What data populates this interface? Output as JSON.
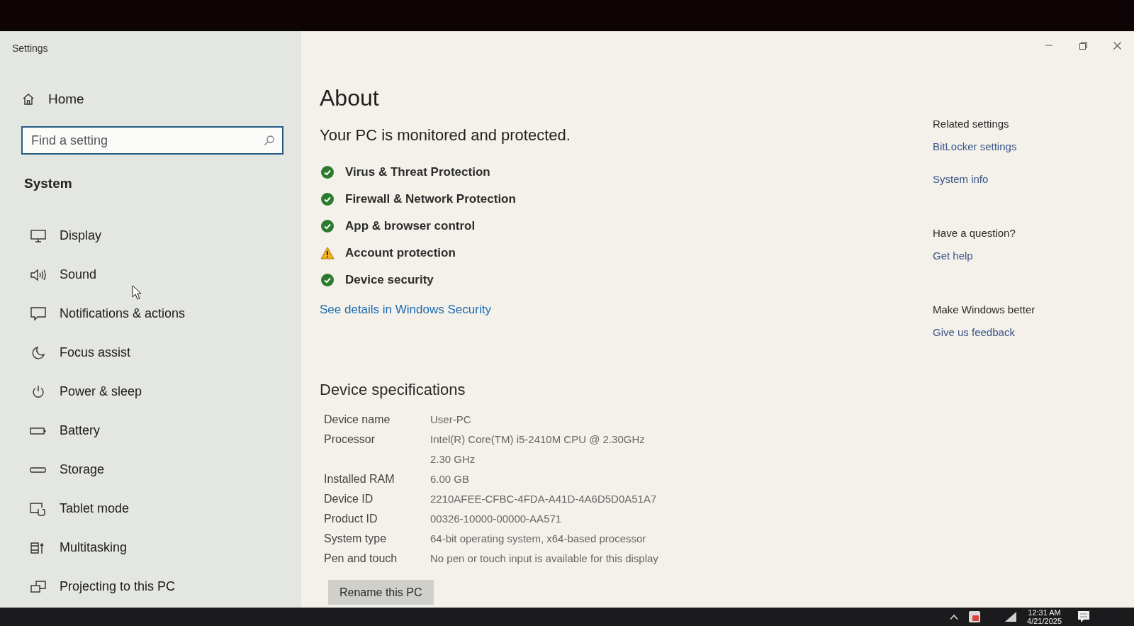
{
  "window": {
    "title": "Settings"
  },
  "sidebar": {
    "home": "Home",
    "search": {
      "placeholder": "Find a setting"
    },
    "section": "System",
    "items": [
      "Display",
      "Sound",
      "Notifications & actions",
      "Focus assist",
      "Power & sleep",
      "Battery",
      "Storage",
      "Tablet mode",
      "Multitasking",
      "Projecting to this PC"
    ]
  },
  "page": {
    "title": "About",
    "protection": {
      "heading": "Your PC is monitored and protected.",
      "items": [
        {
          "label": "Virus & Threat Protection",
          "kind": "ok"
        },
        {
          "label": "Firewall & Network Protection",
          "kind": "ok"
        },
        {
          "label": "App & browser control",
          "kind": "ok"
        },
        {
          "label": "Account protection",
          "kind": "warning"
        },
        {
          "label": "Device security",
          "kind": "ok"
        }
      ],
      "link": "See details in Windows Security"
    },
    "specs": {
      "heading": "Device specifications",
      "rows": [
        {
          "label": "Device name",
          "lines": [
            "User-PC"
          ]
        },
        {
          "label": "Processor",
          "lines": [
            "Intel(R) Core(TM) i5-2410M CPU @ 2.30GHz",
            "2.30 GHz"
          ]
        },
        {
          "label": "Installed RAM",
          "lines": [
            "6.00 GB"
          ]
        },
        {
          "label": "Device ID",
          "lines": [
            "2210AFEE-CFBC-4FDA-A41D-4A6D5D0A51A7"
          ]
        },
        {
          "label": "Product ID",
          "lines": [
            "00326-10000-00000-AA571"
          ]
        },
        {
          "label": "System type",
          "lines": [
            "64-bit operating system, x64-based processor"
          ]
        },
        {
          "label": "Pen and touch",
          "lines": [
            "No pen or touch input is available for this display"
          ]
        }
      ],
      "button": "Rename this PC"
    }
  },
  "related": [
    {
      "heading": "Related settings",
      "links": [
        "BitLocker settings",
        "System info"
      ]
    },
    {
      "heading": "Have a question?",
      "links": [
        "Get help"
      ]
    },
    {
      "heading": "Make Windows better",
      "links": [
        "Give us feedback"
      ]
    }
  ],
  "taskbar": {
    "time": "12:31 AM",
    "date": "4/21/2025"
  }
}
